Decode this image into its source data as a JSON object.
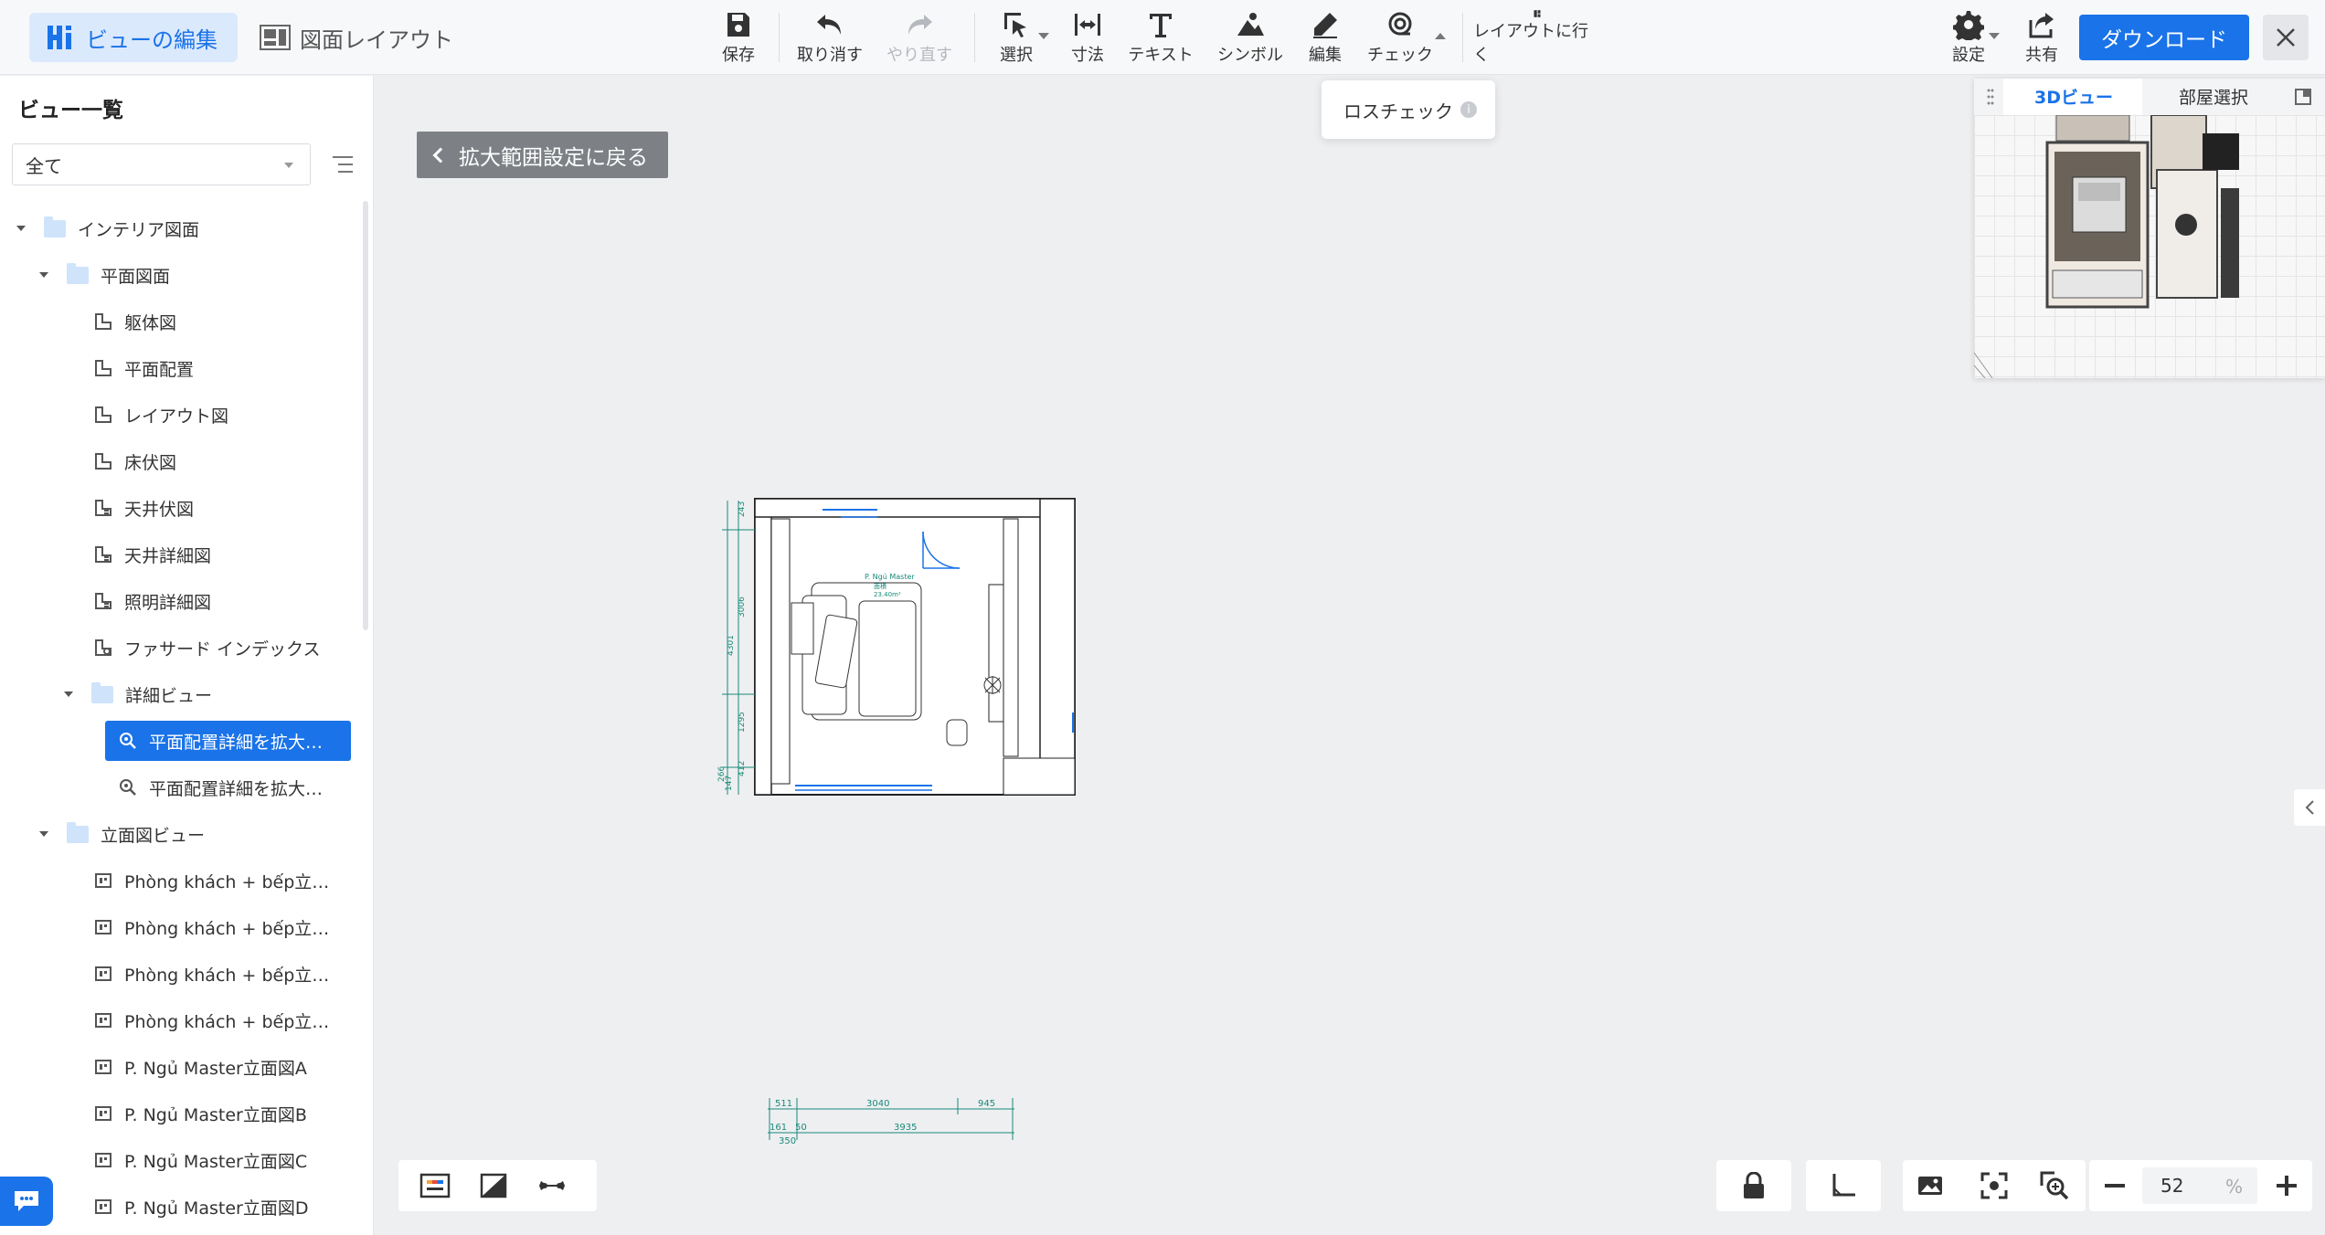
{
  "toolbar": {
    "mode_tabs": [
      {
        "label": "ビューの編集",
        "active": true
      },
      {
        "label": "図面レイアウト",
        "active": false
      }
    ],
    "tools": [
      {
        "label": "保存",
        "icon": "save-icon"
      },
      {
        "label": "取り消す",
        "icon": "undo-icon"
      },
      {
        "label": "やり直す",
        "icon": "redo-icon",
        "disabled": true
      },
      {
        "label": "選択",
        "icon": "select-icon"
      },
      {
        "label": "寸法",
        "icon": "dimension-icon"
      },
      {
        "label": "テキスト",
        "icon": "text-icon"
      },
      {
        "label": "シンボル",
        "icon": "symbol-icon"
      },
      {
        "label": "編集",
        "icon": "pencil-icon"
      },
      {
        "label": "チェック",
        "icon": "check-icon"
      },
      {
        "label": "レイアウトに行く",
        "icon": "layout-icon"
      }
    ],
    "settings_label": "設定",
    "share_label": "共有",
    "download_label": "ダウンロード",
    "accent_color": "#1a73e8"
  },
  "check_dropdown": {
    "item": "ロスチェック"
  },
  "sidebar": {
    "title": "ビュー一覧",
    "filter_value": "全て",
    "tree": [
      {
        "label": "インテリア図面",
        "type": "folder",
        "level": 0
      },
      {
        "label": "平面図面",
        "type": "folder",
        "level": 1
      },
      {
        "label": "躯体図",
        "type": "plan",
        "level": 2
      },
      {
        "label": "平面配置",
        "type": "plan",
        "level": 2
      },
      {
        "label": "レイアウト図",
        "type": "plan",
        "level": 2
      },
      {
        "label": "床伏図",
        "type": "plan",
        "level": 2
      },
      {
        "label": "天井伏図",
        "type": "ceiling",
        "level": 2
      },
      {
        "label": "天井詳細図",
        "type": "ceiling",
        "level": 2
      },
      {
        "label": "照明詳細図",
        "type": "ceiling",
        "level": 2
      },
      {
        "label": "ファサード インデックス",
        "type": "facade",
        "level": 2
      },
      {
        "label": "詳細ビュー",
        "type": "folder",
        "level": 2
      },
      {
        "label": "平面配置詳細を拡大…",
        "type": "detail",
        "level": 3,
        "selected": true
      },
      {
        "label": "平面配置詳細を拡大…",
        "type": "detail",
        "level": 3
      },
      {
        "label": "立面図ビュー",
        "type": "folder",
        "level": 1
      },
      {
        "label": "Phòng khách + bếp立…",
        "type": "elevation",
        "level": 2
      },
      {
        "label": "Phòng khách + bếp立…",
        "type": "elevation",
        "level": 2
      },
      {
        "label": "Phòng khách + bếp立…",
        "type": "elevation",
        "level": 2
      },
      {
        "label": "Phòng khách + bếp立…",
        "type": "elevation",
        "level": 2
      },
      {
        "label": "P. Ngủ Master立面図A",
        "type": "elevation",
        "level": 2
      },
      {
        "label": "P. Ngủ Master立面図B",
        "type": "elevation",
        "level": 2
      },
      {
        "label": "P. Ngủ Master立面図C",
        "type": "elevation",
        "level": 2
      },
      {
        "label": "P. Ngủ Master立面図D",
        "type": "elevation",
        "level": 2
      }
    ]
  },
  "canvas": {
    "back_button": "拡大範囲設定に戻る",
    "plan_labels": {
      "dim_left": [
        "243",
        "3006",
        "4301",
        "1295",
        "412",
        "266",
        "147"
      ],
      "dim_bottom_top": [
        "511",
        "3040",
        "945"
      ],
      "dim_bottom_bottom": [
        "161",
        "50",
        "3935",
        "350"
      ],
      "room_text": [
        "P. Ngủ Master",
        "面積",
        "23.40m²"
      ]
    }
  },
  "minimap": {
    "tabs": [
      "3Dビュー",
      "部屋選択"
    ],
    "active_tab": "3Dビュー"
  },
  "zoom": {
    "value": "52",
    "unit": "%"
  }
}
